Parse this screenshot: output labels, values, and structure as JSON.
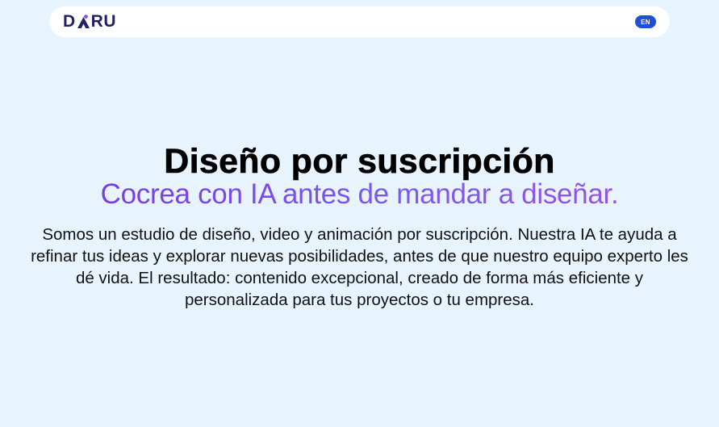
{
  "header": {
    "logo_prefix": "D",
    "logo_suffix": "RU",
    "logo_brand": "DARU",
    "language_button": "EN",
    "colors": {
      "navbar_bg": "#ffffff",
      "logo_text": "#1f2363",
      "language_button_bg": "#1d4fd8"
    }
  },
  "hero": {
    "title": "Diseño por suscripción",
    "subtitle": "Cocrea con IA antes de mandar a diseñar.",
    "body": "Somos un estudio de diseño, video y animación por suscripción. Nuestra IA te ayuda a refinar tus ideas y explorar nuevas posibilidades, antes de que nuestro equipo experto les dé vida. El resultado: contenido excepcional, creado de forma más eficiente y personalizada para tus proyectos o tu empresa.",
    "colors": {
      "page_bg": "#e7f3fd",
      "subtitle_gradient_start": "#7a31e6",
      "subtitle_gradient_end": "#a44fe0"
    }
  }
}
